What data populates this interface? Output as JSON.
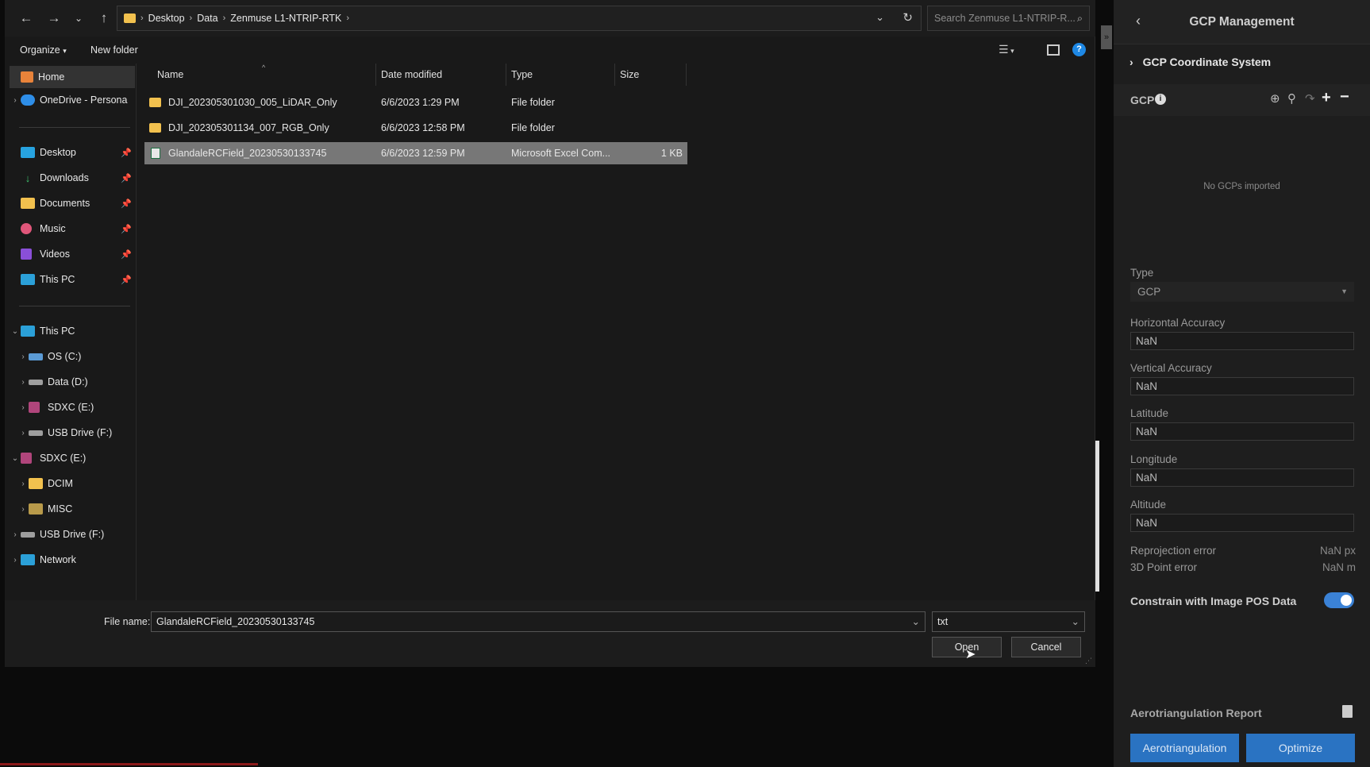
{
  "address": {
    "crumbs": [
      "Desktop",
      "Data",
      "Zenmuse L1-NTRIP-RTK"
    ],
    "search_placeholder": "Search Zenmuse L1-NTRIP-R..."
  },
  "toolbar": {
    "organize": "Organize",
    "new_folder": "New folder"
  },
  "nav": {
    "home": "Home",
    "onedrive": "OneDrive - Persona",
    "quick": [
      "Desktop",
      "Downloads",
      "Documents",
      "Music",
      "Videos",
      "This PC"
    ],
    "this_pc": "This PC",
    "drives": [
      "OS (C:)",
      "Data (D:)",
      "SDXC (E:)",
      "USB Drive (F:)"
    ],
    "sdxc": "SDXC (E:)",
    "sdxc_children": [
      "DCIM",
      "MISC"
    ],
    "usb": "USB Drive (F:)",
    "network": "Network"
  },
  "columns": {
    "name": "Name",
    "date": "Date modified",
    "type": "Type",
    "size": "Size"
  },
  "files": [
    {
      "name": "DJI_202305301030_005_LiDAR_Only",
      "date": "6/6/2023 1:29 PM",
      "type": "File folder",
      "size": ""
    },
    {
      "name": "DJI_202305301134_007_RGB_Only",
      "date": "6/6/2023 12:58 PM",
      "type": "File folder",
      "size": ""
    },
    {
      "name": "GlandaleRCField_20230530133745",
      "date": "6/6/2023 12:59 PM",
      "type": "Microsoft Excel Com...",
      "size": "1 KB"
    }
  ],
  "footer": {
    "file_name_label": "File name:",
    "file_name_value": "GlandaleRCField_20230530133745",
    "file_type": "txt",
    "open": "Open",
    "cancel": "Cancel"
  },
  "panel": {
    "title": "GCP Management",
    "coord_system": "GCP Coordinate System",
    "gcp_label": "GCP",
    "empty_text": "No GCPs imported",
    "type_label": "Type",
    "type_value": "GCP",
    "horizontal_label": "Horizontal Accuracy",
    "horizontal_value": "NaN",
    "vertical_label": "Vertical Accuracy",
    "vertical_value": "NaN",
    "latitude_label": "Latitude",
    "latitude_value": "NaN",
    "longitude_label": "Longitude",
    "longitude_value": "NaN",
    "altitude_label": "Altitude",
    "altitude_value": "NaN",
    "reproj_label": "Reprojection error",
    "reproj_value": "NaN px",
    "point_label": "3D Point error",
    "point_value": "NaN m",
    "constrain_label": "Constrain with Image POS Data",
    "report_label": "Aerotriangulation Report",
    "aerotriangulation_btn": "Aerotriangulation",
    "optimize_btn": "Optimize"
  },
  "colors": {
    "accent": "#2a73c2",
    "toggle": "#3b82d6",
    "selection": "#777777",
    "folder": "#f2c14e"
  }
}
